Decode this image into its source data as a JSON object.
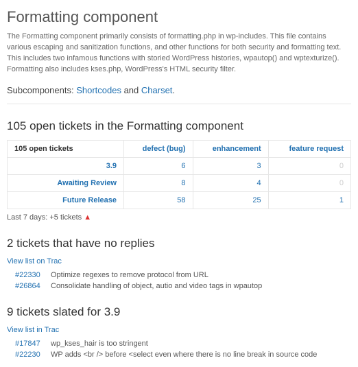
{
  "title": "Formatting component",
  "intro": "The Formatting component primarily consists of formatting.php in wp-includes. This file contains various escaping and sanitization functions, and other functions for both security and formatting text. This includes two infamous functions with storied WordPress histories, wpautop() and wptexturize(). Formatting also includes kses.php, WordPress's HTML security filter.",
  "sub_label": "Subcomponents: ",
  "sub_links": {
    "a": "Shortcodes",
    "and": " and ",
    "b": "Charset",
    "dot": "."
  },
  "table_heading": "105 open tickets in the Formatting component",
  "table": {
    "corner": "105 open tickets",
    "cols": [
      "defect (bug)",
      "enhancement",
      "feature request"
    ],
    "rows": [
      {
        "label": "3.9",
        "cells": [
          "6",
          "3",
          "0"
        ],
        "muted": [
          false,
          false,
          true
        ]
      },
      {
        "label": "Awaiting Review",
        "cells": [
          "8",
          "4",
          "0"
        ],
        "muted": [
          false,
          false,
          true
        ]
      },
      {
        "label": "Future Release",
        "cells": [
          "58",
          "25",
          "1"
        ],
        "muted": [
          false,
          false,
          false
        ]
      }
    ]
  },
  "last7": {
    "text": "Last 7 days: +5 tickets ",
    "icon": "▲"
  },
  "noreplies": {
    "heading": "2 tickets that have no replies",
    "viewlink": "View list on Trac",
    "items": [
      {
        "id": "#22330",
        "sum": "Optimize regexes to remove protocol from URL"
      },
      {
        "id": "#26864",
        "sum": "Consolidate handling of object, autio and video tags in wpautop"
      }
    ]
  },
  "slated": {
    "heading": "9 tickets slated for 3.9",
    "viewlink": "View list in Trac",
    "items": [
      {
        "id": "#17847",
        "sum": "wp_kses_hair is too stringent"
      },
      {
        "id": "#22230",
        "sum": "WP adds <br /> before <select even where there is no line break in source code"
      }
    ]
  }
}
